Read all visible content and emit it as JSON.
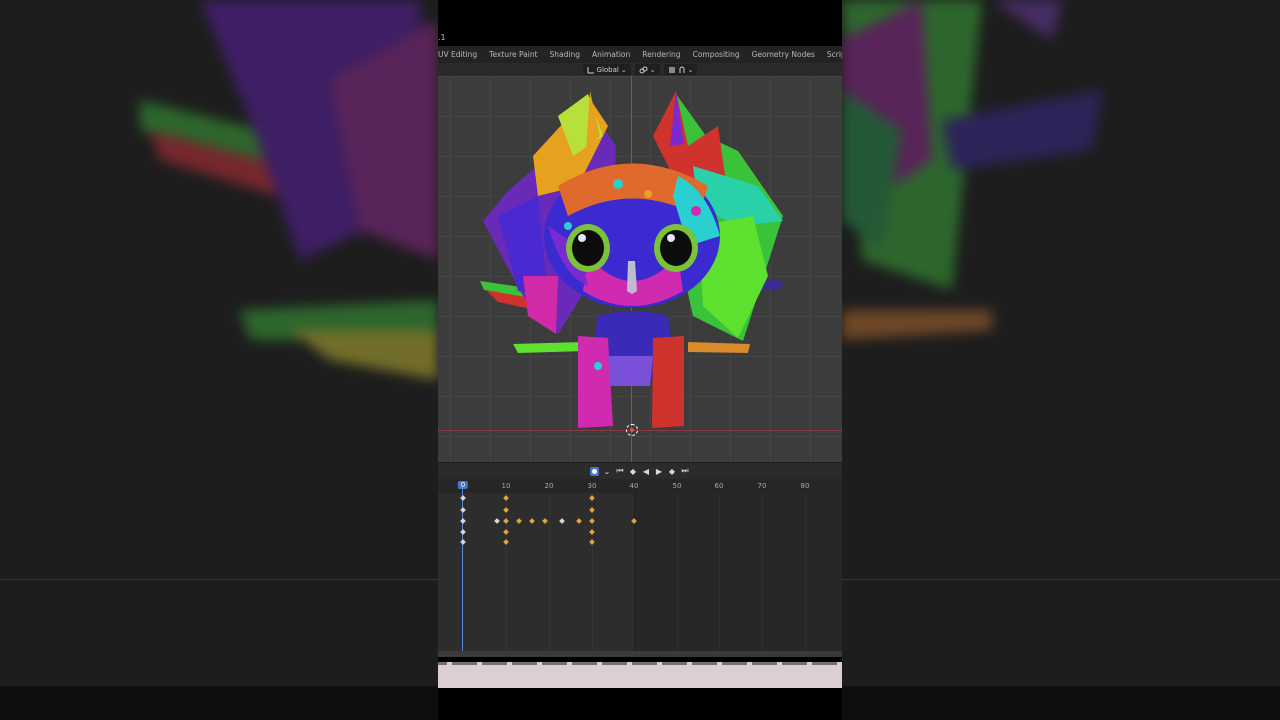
{
  "app": {
    "version_fragment": ".1",
    "workspace_tabs": [
      {
        "label": "UV Editing"
      },
      {
        "label": "Texture Paint"
      },
      {
        "label": "Shading"
      },
      {
        "label": "Animation"
      },
      {
        "label": "Rendering"
      },
      {
        "label": "Compositing"
      },
      {
        "label": "Geometry Nodes"
      },
      {
        "label": "Scripting"
      }
    ],
    "add_tab_symbol": "+"
  },
  "viewport_header": {
    "orientation_label": "Global",
    "orientation_icon": "transform-orientation-icon",
    "pivot_icon": "pivot-link-icon",
    "snap_icon": "snap-magnet-icon",
    "proportional_icon": "proportional-edit-icon"
  },
  "timeline": {
    "current_frame": "0",
    "end_frame_value": 40,
    "ruler_labels": [
      "0",
      "10",
      "20",
      "30",
      "40",
      "50",
      "60",
      "70",
      "80"
    ],
    "controls": {
      "record_icon": "auto-keying-record-icon",
      "jump_start_icon": "jump-start-icon",
      "prev_key_icon": "jump-prev-keyframe-icon",
      "play_reverse_icon": "play-reverse-icon",
      "play_icon": "play-icon",
      "next_key_icon": "jump-next-keyframe-icon",
      "jump_end_icon": "jump-end-icon",
      "glyphs": {
        "jump_start": "⏮",
        "prev_key": "◆",
        "play_reverse": "◀",
        "play": "▶",
        "next_key": "◆",
        "jump_end": "⏭"
      }
    },
    "keyframes_description": "keyframes shown as orange diamonds at frames 0, 8, 10, 13, 16, 19, 23, 27, 30, 40"
  },
  "colors": {
    "accent_blue": "#4a74c9",
    "keyframe_orange": "#e8a33a",
    "viewport_bg": "#3c3c3c",
    "x_axis_red": "#8a3a46"
  }
}
